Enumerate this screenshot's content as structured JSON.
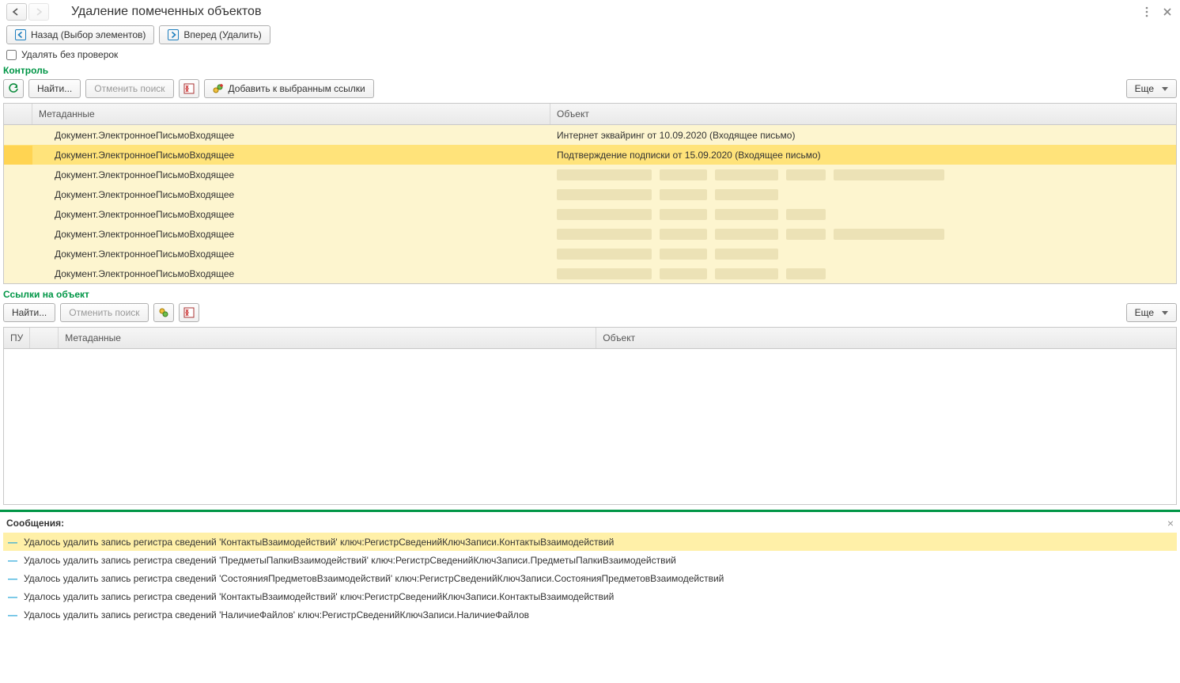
{
  "header": {
    "title": "Удаление помеченных объектов",
    "back_label": "Назад (Выбор элементов)",
    "forward_label": "Вперед (Удалить)"
  },
  "check_row": {
    "label": "Удалять без проверок",
    "checked": false
  },
  "section_control": {
    "title": "Контроль",
    "find": "Найти...",
    "cancel_find": "Отменить поиск",
    "add_refs": "Добавить к выбранным ссылки",
    "more": "Еще",
    "columns": {
      "metadata": "Метаданные",
      "object": "Объект"
    },
    "selected_index": 1,
    "rows": [
      {
        "metadata": "Документ.ЭлектронноеПисьмоВходящее",
        "object": "Интернет эквайринг от 10.09.2020 (Входящее письмо)"
      },
      {
        "metadata": "Документ.ЭлектронноеПисьмоВходящее",
        "object": "Подтверждение подписки от 15.09.2020 (Входящее письмо)"
      },
      {
        "metadata": "Документ.ЭлектронноеПисьмоВходящее",
        "object": ""
      },
      {
        "metadata": "Документ.ЭлектронноеПисьмоВходящее",
        "object": ""
      },
      {
        "metadata": "Документ.ЭлектронноеПисьмоВходящее",
        "object": ""
      },
      {
        "metadata": "Документ.ЭлектронноеПисьмоВходящее",
        "object": ""
      },
      {
        "metadata": "Документ.ЭлектронноеПисьмоВходящее",
        "object": ""
      },
      {
        "metadata": "Документ.ЭлектронноеПисьмоВходящее",
        "object": ""
      }
    ]
  },
  "section_refs": {
    "title": "Ссылки на объект",
    "find": "Найти...",
    "cancel_find": "Отменить поиск",
    "more": "Еще",
    "columns": {
      "pu": "ПУ",
      "metadata": "Метаданные",
      "object": "Объект"
    }
  },
  "messages": {
    "title": "Сообщения:",
    "selected_index": 0,
    "items": [
      "Удалось удалить запись регистра сведений 'КонтактыВзаимодействий' ключ:РегистрСведенийКлючЗаписи.КонтактыВзаимодействий",
      "Удалось удалить запись регистра сведений 'ПредметыПапкиВзаимодействий' ключ:РегистрСведенийКлючЗаписи.ПредметыПапкиВзаимодействий",
      "Удалось удалить запись регистра сведений 'СостоянияПредметовВзаимодействий' ключ:РегистрСведенийКлючЗаписи.СостоянияПредметовВзаимодействий",
      "Удалось удалить запись регистра сведений 'КонтактыВзаимодействий' ключ:РегистрСведенийКлючЗаписи.КонтактыВзаимодействий",
      "Удалось удалить запись регистра сведений 'НаличиеФайлов' ключ:РегистрСведенийКлючЗаписи.НаличиеФайлов"
    ]
  }
}
